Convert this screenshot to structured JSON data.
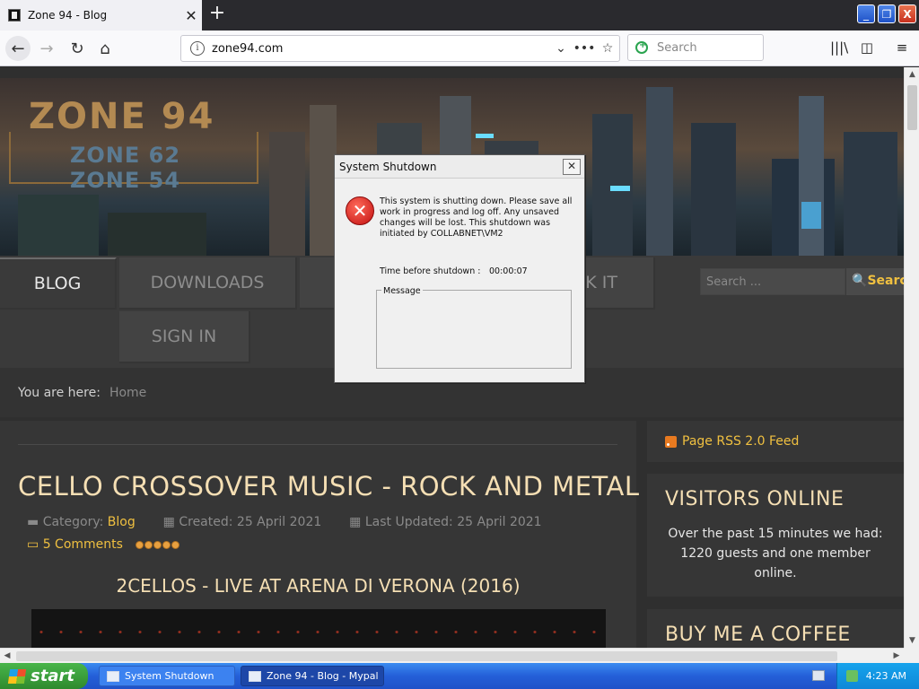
{
  "browser": {
    "tab_title": "Zone 94 - Blog",
    "new_tab_icon": "plus-icon",
    "url": "zone94.com",
    "search_placeholder": "Search",
    "window_buttons": {
      "minimize": "_",
      "restore": "❐",
      "close": "X"
    }
  },
  "hero": {
    "logo_line1": "ZONE 94",
    "logo_line2": "ZONE 62",
    "logo_line3": "ZONE 54"
  },
  "nav": {
    "items": [
      {
        "label": "BLOG"
      },
      {
        "label": "DOWNLOADS"
      },
      {
        "label": "CK IT"
      },
      {
        "label": "SIGN IN"
      }
    ],
    "search_placeholder": "Search ...",
    "search_button": "Search"
  },
  "breadcrumb": {
    "label": "You are here:",
    "home": "Home"
  },
  "article": {
    "title": "CELLO CROSSOVER MUSIC - ROCK AND METAL",
    "category_label": "Category:",
    "category": "Blog",
    "created": "Created: 25 April 2021",
    "updated": "Last Updated: 25 April 2021",
    "comments": "5 Comments",
    "rating": 5,
    "subtitle": "2CELLOS - LIVE AT ARENA DI VERONA (2016)"
  },
  "sidebar": {
    "rss": "Page RSS 2.0 Feed",
    "visitors_title": "VISITORS ONLINE",
    "visitors_text": "Over the past 15 minutes we had: 1220 guests and one member online.",
    "coffee_title": "BUY ME A COFFEE"
  },
  "dialog": {
    "title": "System Shutdown",
    "message": "This system is shutting down. Please save all work in progress and log off. Any unsaved changes will be lost. This shutdown was initiated by COLLABNET\\VM2",
    "time_label": "Time before shutdown :",
    "time_value": "00:00:07",
    "group_label": "Message"
  },
  "taskbar": {
    "start": "start",
    "tasks": [
      {
        "label": "System Shutdown"
      },
      {
        "label": "Zone 94 - Blog - Mypal"
      }
    ],
    "clock": "4:23 AM"
  },
  "colors": {
    "accent_gold": "#f0c040",
    "title_cream": "#f5dfb4",
    "xp_blue": "#245fd8",
    "xp_green": "#2f8a2e"
  }
}
